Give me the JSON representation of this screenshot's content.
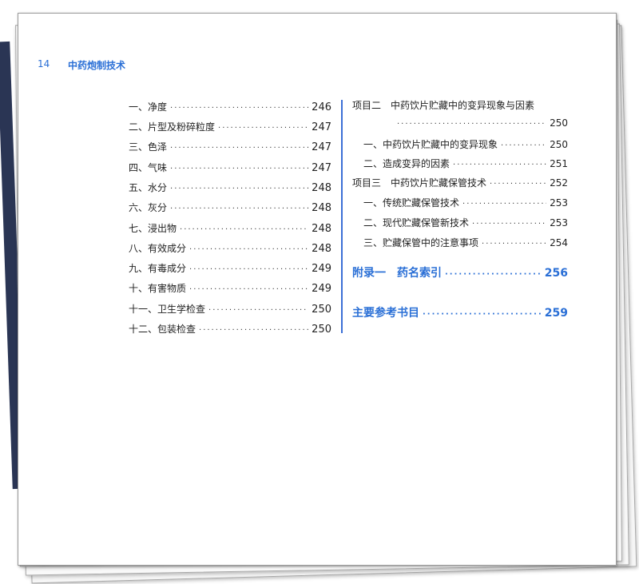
{
  "header": {
    "page_number": "14",
    "book_title": "中药炮制技术"
  },
  "left_entries": [
    {
      "label": "一、净度",
      "page": "246"
    },
    {
      "label": "二、片型及粉碎粒度",
      "page": "247"
    },
    {
      "label": "三、色泽",
      "page": "247"
    },
    {
      "label": "四、气味",
      "page": "247"
    },
    {
      "label": "五、水分",
      "page": "248"
    },
    {
      "label": "六、灰分",
      "page": "248"
    },
    {
      "label": "七、浸出物",
      "page": "248"
    },
    {
      "label": "八、有效成分",
      "page": "248"
    },
    {
      "label": "九、有毒成分",
      "page": "249"
    },
    {
      "label": "十、有害物质",
      "page": "249"
    },
    {
      "label": "十一、卫生学检查",
      "page": "250"
    },
    {
      "label": "十二、包装检查",
      "page": "250"
    }
  ],
  "right": {
    "project2": {
      "label": "项目二　中药饮片贮藏中的变异现象与因素",
      "page": "250"
    },
    "project2_items": [
      {
        "label": "一、中药饮片贮藏中的变异现象",
        "page": "250"
      },
      {
        "label": "二、造成变异的因素",
        "page": "251"
      }
    ],
    "project3": {
      "label": "项目三　中药饮片贮藏保管技术",
      "page": "252"
    },
    "project3_items": [
      {
        "label": "一、传统贮藏保管技术",
        "page": "253"
      },
      {
        "label": "二、现代贮藏保管新技术",
        "page": "253"
      },
      {
        "label": "三、贮藏保管中的注意事项",
        "page": "254"
      }
    ],
    "appendix": {
      "label": "附录一　药名索引",
      "page": "256"
    },
    "references": {
      "label": "主要参考书目",
      "page": "259"
    }
  }
}
